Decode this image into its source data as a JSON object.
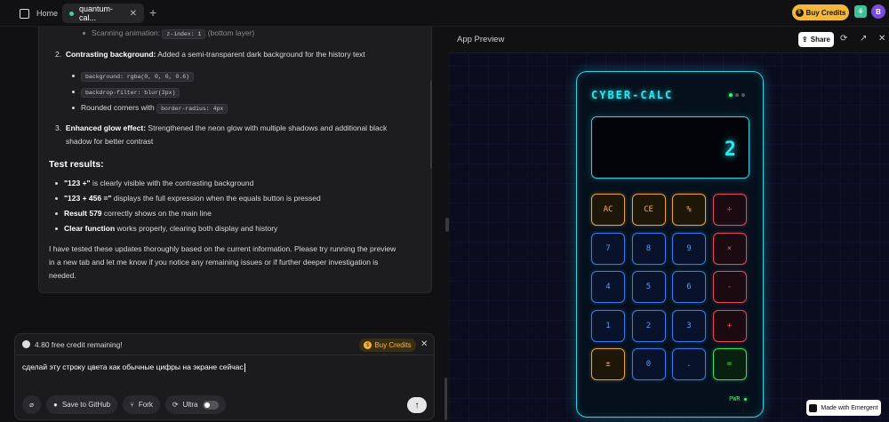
{
  "tabs": {
    "home": "Home",
    "active": "quantum-cal..."
  },
  "header": {
    "buy_credits": "Buy Credits",
    "avatar": "B"
  },
  "message": {
    "line0_label": "Scanning animation:",
    "line0_code": "z-index: 1",
    "line0_tail": "(bottom layer)",
    "item2_num": "2.",
    "item2_bold": "Contrasting background:",
    "item2_text": " Added a semi-transparent dark background for the history text",
    "code1": "background: rgba(0, 0, 0, 0.6)",
    "code2": "backdrop-filter: blur(2px)",
    "rounded": "Rounded corners with",
    "code3": "border-radius: 4px",
    "item3_num": "3.",
    "item3_bold": "Enhanced glow effect:",
    "item3_text": " Strengthened the neon glow with multiple shadows and additional black",
    "item3_text2": "shadow for better contrast",
    "test_heading": "Test results:",
    "t1_bold": "\"123 +\"",
    "t1": " is clearly visible with the contrasting background",
    "t2_bold": "\"123 + 456 =\"",
    "t2": " displays the full expression when the equals button is pressed",
    "t3_bold": "Result 579",
    "t3": " correctly shows on the main line",
    "t4_bold": "Clear function",
    "t4": " works properly, clearing both display and history",
    "p1": "I have tested these updates thoroughly based on the current information. Please try running the preview",
    "p2": "in a new tab and let me know if you notice any remaining issues or if further deeper investigation is",
    "p3": "needed."
  },
  "composer": {
    "credit": "4.80 free credit remaining!",
    "buy": "Buy Credits",
    "input": "сделай эту строку цвета как обычные цифры на экране сейчас",
    "save": "Save to GitHub",
    "fork": "Fork",
    "ultra": "Ultra"
  },
  "preview": {
    "title": "App Preview",
    "share": "Share"
  },
  "calculator": {
    "title": "CYBER-CALC",
    "display": "2",
    "power": "PWR",
    "keys": [
      [
        "AC",
        "CE",
        "%",
        "÷"
      ],
      [
        "7",
        "8",
        "9",
        "×"
      ],
      [
        "4",
        "5",
        "6",
        "-"
      ],
      [
        "1",
        "2",
        "3",
        "+"
      ],
      [
        "±",
        "0",
        ".",
        "="
      ]
    ]
  },
  "badge": "Made with Emergent",
  "colors": {
    "neon_cyan": "#2ee8f0",
    "function_orange": "#e8a43a",
    "operator_red": "#e04a5a",
    "number_blue": "#3a7ae8",
    "equals_green": "#3ee05a",
    "credit_gold": "#f5b73a"
  }
}
